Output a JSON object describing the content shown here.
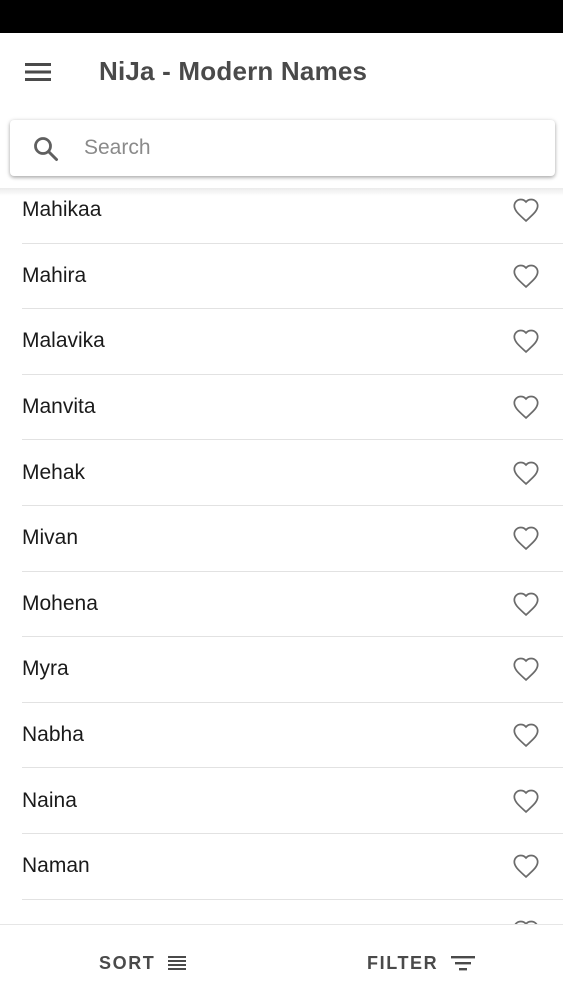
{
  "app_bar": {
    "title": "NiJa - Modern Names",
    "menu_icon": "menu-icon"
  },
  "search": {
    "placeholder": "Search",
    "value": "",
    "icon": "search-icon"
  },
  "names": [
    {
      "label": "Mahikaa"
    },
    {
      "label": "Mahira"
    },
    {
      "label": "Malavika"
    },
    {
      "label": "Manvita"
    },
    {
      "label": "Mehak"
    },
    {
      "label": "Mivan"
    },
    {
      "label": "Mohena"
    },
    {
      "label": "Myra"
    },
    {
      "label": "Nabha"
    },
    {
      "label": "Naina"
    },
    {
      "label": "Naman"
    },
    {
      "label": ""
    }
  ],
  "favorite_icon": "heart-outline-icon",
  "bottom_bar": {
    "sort_label": "SORT",
    "sort_icon": "sort-lines-icon",
    "filter_label": "FILTER",
    "filter_icon": "filter-icon"
  },
  "colors": {
    "status_bar": "#000000",
    "title": "#4a4a4a",
    "icon": "#5f5f5f",
    "divider": "#e2e2e2"
  }
}
